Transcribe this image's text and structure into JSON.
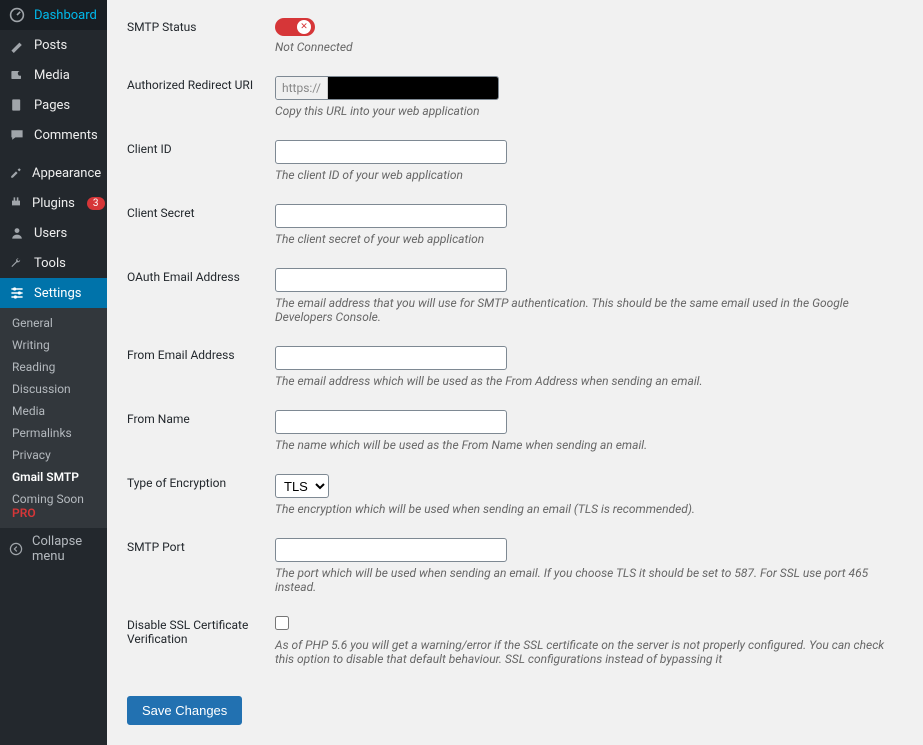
{
  "sidebar": {
    "items": [
      {
        "label": "Dashboard"
      },
      {
        "label": "Posts"
      },
      {
        "label": "Media"
      },
      {
        "label": "Pages"
      },
      {
        "label": "Comments"
      },
      {
        "label": "Appearance"
      },
      {
        "label": "Plugins",
        "badge": "3"
      },
      {
        "label": "Users"
      },
      {
        "label": "Tools"
      },
      {
        "label": "Settings"
      }
    ],
    "settings_sub": [
      {
        "label": "General"
      },
      {
        "label": "Writing"
      },
      {
        "label": "Reading"
      },
      {
        "label": "Discussion"
      },
      {
        "label": "Media"
      },
      {
        "label": "Permalinks"
      },
      {
        "label": "Privacy"
      },
      {
        "label": "Gmail SMTP",
        "current": true
      },
      {
        "label": "Coming Soon",
        "pro": "PRO"
      }
    ],
    "collapse": "Collapse menu"
  },
  "form": {
    "smtp_status": {
      "label": "SMTP Status",
      "desc": "Not Connected"
    },
    "redirect_uri": {
      "label": "Authorized Redirect URI",
      "scheme": "https://",
      "desc": "Copy this URL into your web application"
    },
    "client_id": {
      "label": "Client ID",
      "value": "",
      "desc": "The client ID of your web application"
    },
    "client_secret": {
      "label": "Client Secret",
      "value": "",
      "desc": "The client secret of your web application"
    },
    "oauth_email": {
      "label": "OAuth Email Address",
      "value": "",
      "desc": "The email address that you will use for SMTP authentication. This should be the same email used in the Google Developers Console."
    },
    "from_email": {
      "label": "From Email Address",
      "value": "",
      "desc": "The email address which will be used as the From Address when sending an email."
    },
    "from_name": {
      "label": "From Name",
      "value": "",
      "desc": "The name which will be used as the From Name when sending an email."
    },
    "encryption": {
      "label": "Type of Encryption",
      "value": "TLS",
      "desc": "The encryption which will be used when sending an email (TLS is recommended)."
    },
    "smtp_port": {
      "label": "SMTP Port",
      "value": "",
      "desc": "The port which will be used when sending an email. If you choose TLS it should be set to 587. For SSL use port 465 instead."
    },
    "disable_ssl": {
      "label": "Disable SSL Certificate Verification",
      "desc": "As of PHP 5.6 you will get a warning/error if the SSL certificate on the server is not properly configured. You can check this option to disable that default behaviour. SSL configurations instead of bypassing it"
    }
  },
  "save_button": "Save Changes"
}
